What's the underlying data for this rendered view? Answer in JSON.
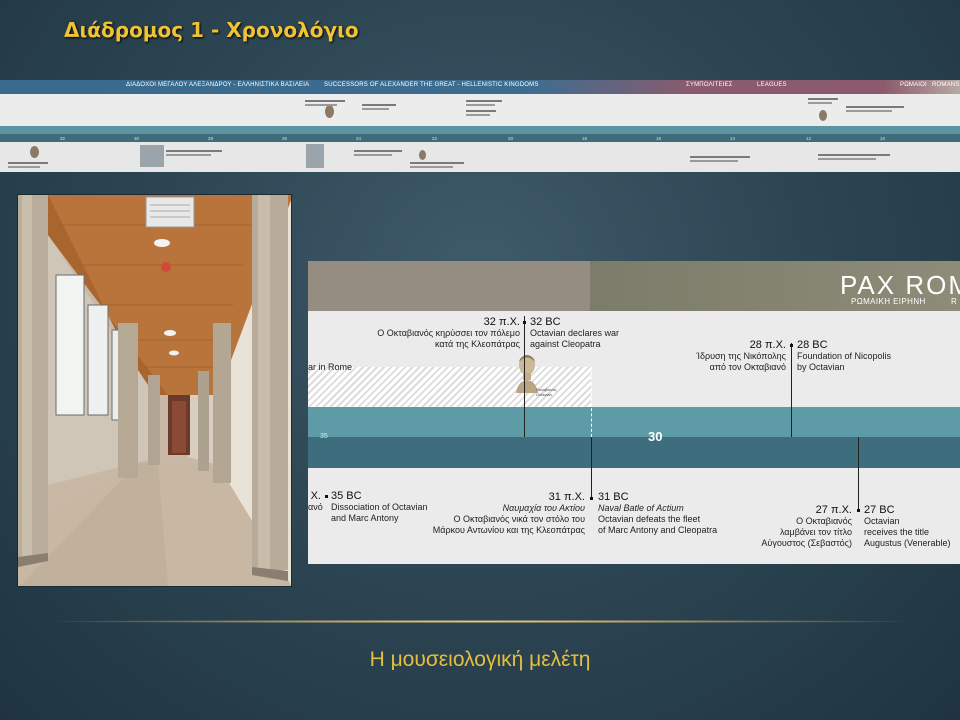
{
  "slide": {
    "title": "Διάδρομος 1 - Χρονολόγιο",
    "caption": "Η μουσειολογική μελέτη"
  },
  "overview_strip": {
    "header_labels": [
      "ΔΙΑΔΟΧΟΙ ΜΕΓΑΛΟΥ ΑΛΕΞΑΝΔΡΟΥ - ΕΛΛΗΝΙΣΤΙΚΑ ΒΑΣΙΛΕΙΑ",
      "SUCCESSORS OF ALEXANDER THE GREAT - HELLENISTIC KINGDOMS",
      "ΣΥΜΠΟΛΙΤΕΙΕΣ",
      "LEAGUES",
      "ΡΩΜΑΙΟΙ",
      "ROMANS"
    ],
    "ticks": [
      "32",
      "30",
      "28",
      "26",
      "24",
      "22",
      "20",
      "18",
      "16",
      "14",
      "12",
      "10",
      "8",
      "6"
    ],
    "header_colors": {
      "hellenistic": "#3a6b8e",
      "leagues": "#8a5b6e",
      "romans": "#b8a9a3"
    }
  },
  "photo": {
    "subject": "museum-corridor"
  },
  "timeline_detail": {
    "era_title": "PAX ROM",
    "era_subtitle_gr": "ΡΩΜΑΙΚΗ ΕΙΡΗΝΗ",
    "era_subtitle_cont": "R",
    "rome_label": "ar in Rome",
    "band_center_number": "30",
    "band_small_number": "35",
    "bust_caption": [
      "Οκταβιανός",
      "Octavian"
    ],
    "events_upper": [
      {
        "date_gr": "32 π.Χ.",
        "date_en": "32 BC",
        "text_gr": [
          "Ο Οκταβιανός κηρύσσει τον πόλεμο",
          "κατά της Κλεοπάτρας"
        ],
        "text_en": [
          "Octavian declares war",
          "against Cleopatra"
        ]
      },
      {
        "date_gr": "28 π.Χ.",
        "date_en": "28 BC",
        "text_gr": [
          "Ίδρυση της Νικόπολης",
          "από τον Οκταβιανό"
        ],
        "text_en": [
          "Foundation of Nicopolis",
          "by Octavian"
        ]
      }
    ],
    "events_lower": [
      {
        "date_gr": "Χ.",
        "date_en": "35 BC",
        "text_gr": [
          "ανό"
        ],
        "text_en": [
          "Dissociation of Octavian",
          "and Marc Antony"
        ]
      },
      {
        "date_gr": "31 π.Χ.",
        "date_en": "31 BC",
        "title_gr": "Ναυμαχία του Ακτίου",
        "title_en": "Naval Batle of Actium",
        "text_gr": [
          "Ο Οκταβιανός νικά τον στόλο του",
          "Μάρκου Αντωνίου και της Κλεοπάτρας"
        ],
        "text_en": [
          "Octavian defeats the fleet",
          "of Marc Antony and Cleopatra"
        ]
      },
      {
        "date_gr": "27 π.Χ.",
        "date_en": "27 BC",
        "text_gr": [
          "Ο Οκταβιανός",
          "λαμβάνει τον τίτλο",
          "Αύγουστος (Σεβαστός)"
        ],
        "text_en": [
          "Octavian",
          "receives the title",
          "Augustus (Venerable)"
        ]
      }
    ]
  },
  "colors": {
    "title": "#f1c232",
    "caption": "#e3bf3d",
    "band_light": "#5d9ba7",
    "band_dark": "#3e6e7d"
  }
}
